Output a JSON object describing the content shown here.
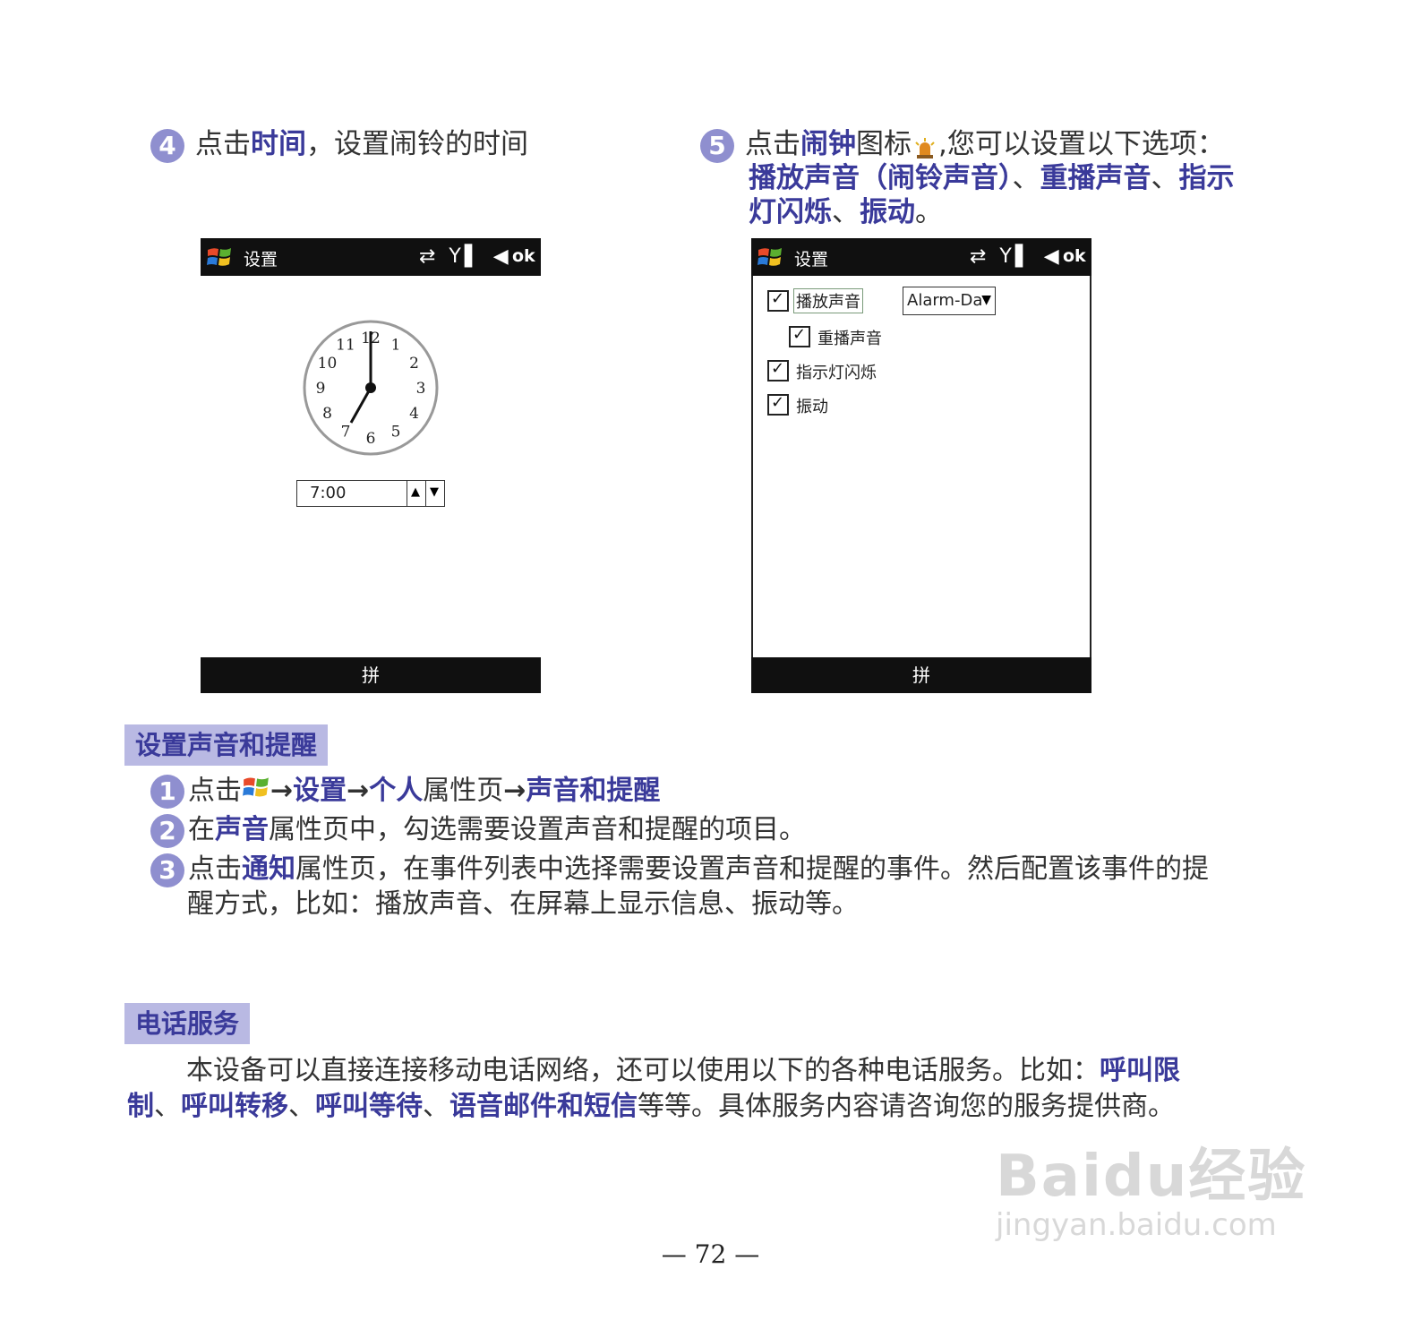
{
  "steps_top": {
    "s4": {
      "num": "4",
      "pre": "点击",
      "bold": "时间",
      "post": "，设置闹铃的时间"
    },
    "s5": {
      "num": "5",
      "pre": "点击",
      "bold": "闹钟",
      "mid": "图标",
      "post": ",您可以设置以下选项：",
      "line2_a": "播放声音（闹铃声音）",
      "sep1": "、",
      "line2_b": "重播声音",
      "sep2": "、",
      "line2_c": "指示",
      "line3_a": "灯闪烁",
      "sep3": "、",
      "line3_b": "振动",
      "end": "。"
    }
  },
  "screen_left": {
    "title": "设置",
    "ok": "ok",
    "time_value": "7:00",
    "bottom": "拼",
    "clock_numbers": [
      "12",
      "1",
      "2",
      "3",
      "4",
      "5",
      "6",
      "7",
      "8",
      "9",
      "10",
      "11"
    ]
  },
  "screen_right": {
    "title": "设置",
    "ok": "ok",
    "bottom": "拼",
    "options": {
      "play_sound": "播放声音",
      "repeat_sound": "重播声音",
      "led_flash": "指示灯闪烁",
      "vibrate": "振动"
    },
    "sound_select": "Alarm-Da"
  },
  "section_sound": {
    "heading": "设置声音和提醒",
    "item1": {
      "num": "1",
      "pre": "点击",
      "a": "设置",
      "b": "个人",
      "mid": "属性页",
      "c": "声音和提醒"
    },
    "item2": {
      "num": "2",
      "pre": "在",
      "bold": "声音",
      "post": "属性页中，勾选需要设置声音和提醒的项目。"
    },
    "item3": {
      "num": "3",
      "pre": "点击",
      "bold": "通知",
      "post": "属性页，在事件列表中选择需要设置声音和提醒的事件。然后配置该事件的提",
      "line2": "醒方式，比如：播放声音、在屏幕上显示信息、振动等。"
    }
  },
  "section_phone": {
    "heading": "电话服务",
    "text1": "本设备可以直接连接移动电话网络，还可以使用以下的各种电话服务。比如：",
    "bold1": "呼叫限",
    "bold1b": "制",
    "sep": "、",
    "bold2": "呼叫转移",
    "bold3": "呼叫等待",
    "bold4": "语音邮件和短信",
    "text2": "等等。具体服务内容请咨询您的服务提供商。"
  },
  "page_number": "— 72 —",
  "watermark": {
    "line1": "Baidu经验",
    "line2": "jingyan.baidu.com"
  }
}
